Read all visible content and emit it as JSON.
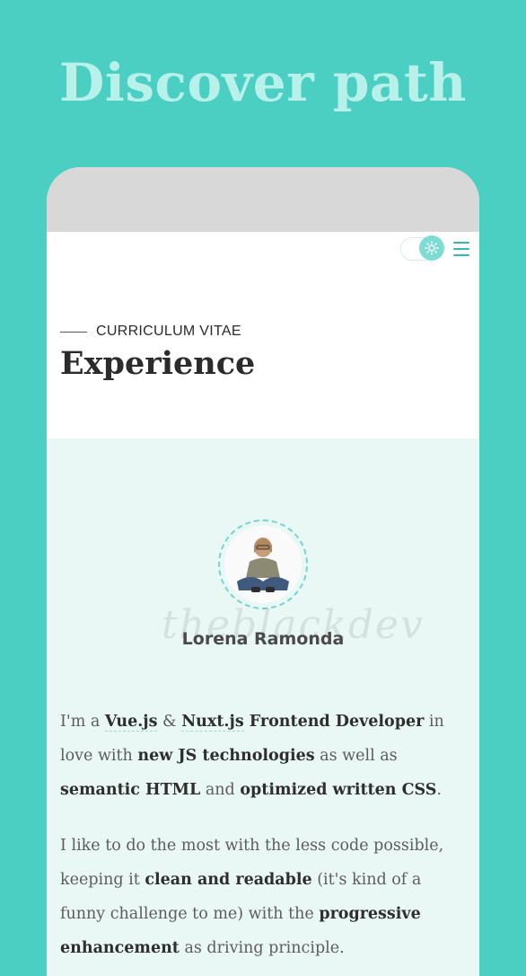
{
  "hero": {
    "title": "Discover path"
  },
  "header": {
    "eyebrow": "CURRICULUM VITAE",
    "title": "Experience",
    "theme_toggle_icon": "sun-icon",
    "menu_icon": "hamburger-icon"
  },
  "profile": {
    "name": "Lorena Ramonda",
    "signature": "theblackdev"
  },
  "bio": {
    "p1": {
      "t1": "I'm a ",
      "link1": "Vue.js",
      "t2": " & ",
      "link2": "Nuxt.js",
      "b1": " Frontend Developer",
      "t3": " in love with ",
      "b2": "new JS technologies",
      "t4": " as well as ",
      "b3": "semantic HTML",
      "t5": " and ",
      "b4": "optimized written CSS",
      "t6": "."
    },
    "p2": {
      "t1": "I like to do the most with the less code possible, keeping it ",
      "b1": "clean and readable",
      "t2": " (it's kind of a funny challenge to me) with the ",
      "b2": "progressive enhancement",
      "t3": " as driving principle."
    }
  },
  "colors": {
    "background": "#4ccfc3",
    "accent": "#35b8ad",
    "hero_text": "#b8f0ea",
    "content_bg": "#eaf8f5"
  }
}
